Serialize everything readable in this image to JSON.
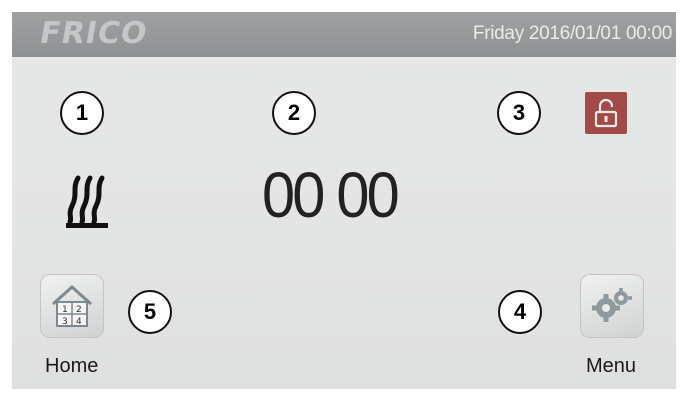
{
  "header": {
    "logo_text": "FRICO",
    "datetime": "Friday 2016/01/01  00:00"
  },
  "main": {
    "time_display": "00 00",
    "heat_mode_icon": "heater-waves-icon",
    "lock_icon": "unlocked-padlock-icon"
  },
  "bottom": {
    "home_label": "Home",
    "home_icon": "home-zones-icon",
    "home_icon_digits": [
      "1",
      "2",
      "3",
      "4"
    ],
    "menu_label": "Menu",
    "menu_icon": "gears-icon"
  },
  "callouts": [
    "1",
    "2",
    "3",
    "4",
    "5"
  ],
  "colors": {
    "topbar": "#9a9d9e",
    "lock_button": "#a14a48",
    "screen_background": "#e3e4e4"
  }
}
